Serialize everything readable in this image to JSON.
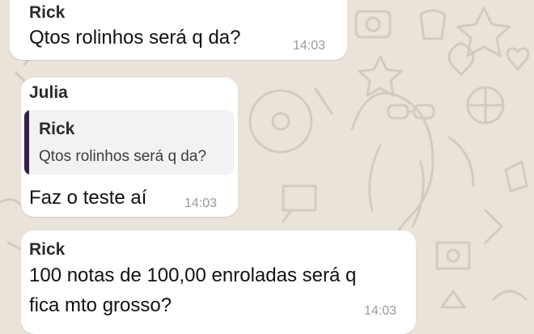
{
  "messages": [
    {
      "sender": "Rick",
      "text": "Qtos rolinhos será q da?",
      "time": "14:03"
    },
    {
      "sender": "Julia",
      "quoted": {
        "sender": "Rick",
        "text": "Qtos rolinhos será q da?"
      },
      "text": "Faz o teste aí",
      "time": "14:03"
    },
    {
      "sender": "Rick",
      "lines": [
        "100 notas de 100,00 enroladas será q",
        "fica mto grosso?"
      ],
      "time": "14:03"
    }
  ],
  "colors": {
    "background": "#e9e3da",
    "bubble": "#ffffff",
    "quote_bar": "#35204a"
  }
}
